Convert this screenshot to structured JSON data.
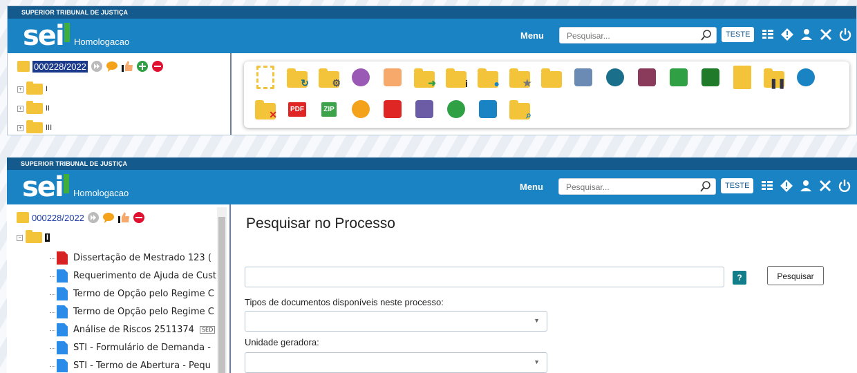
{
  "app": {
    "org": "SUPERIOR TRIBUNAL DE JUSTIÇA",
    "logo": "sei",
    "environment": "Homologacao",
    "menu_label": "Menu",
    "search_placeholder": "Pesquisar...",
    "user_badge": "TESTE"
  },
  "header_icons": [
    "list-icon",
    "alert-icon",
    "user-icon",
    "tools-icon",
    "power-icon"
  ],
  "process_number": "000228/2022",
  "tree_folders": [
    "I",
    "II",
    "III"
  ],
  "toolbar_row1": [
    "new-doc-icon",
    "relate-process-icon",
    "manage-users-icon",
    "view-icon",
    "assign-icon",
    "send-process-icon",
    "process-info-icon",
    "assign-person-icon",
    "highlight-icon",
    "block-icon",
    "email-icon",
    "refresh-icon",
    "add-attachment-icon",
    "units-icon",
    "brazil-map-icon",
    "note-icon",
    "pause-icon",
    "link-icon"
  ],
  "toolbar_row2": [
    "cancel-icon",
    "PDF",
    "ZIP",
    "comment-icon",
    "flag-icon",
    "tag-icon",
    "clock-icon",
    "list-icon",
    "search-folder-icon"
  ],
  "tree2_open_folder": "I",
  "documents": [
    {
      "title": "Dissertação de Mestrado 123 (",
      "type": "pdf"
    },
    {
      "title": "Requerimento de Ajuda de Cust",
      "type": "doc"
    },
    {
      "title": "Termo de Opção pelo Regime C",
      "type": "doc"
    },
    {
      "title": "Termo de Opção pelo Regime C",
      "type": "doc"
    },
    {
      "title": "Análise de Riscos 2511374",
      "type": "doc",
      "tag": "SED"
    },
    {
      "title": "STI - Formulário de Demanda -",
      "type": "doc"
    },
    {
      "title": "STI - Termo de Abertura - Pequ",
      "type": "doc"
    }
  ],
  "search_page": {
    "title": "Pesquisar no Processo",
    "help": "?",
    "button": "Pesquisar",
    "doc_types_label": "Tipos de documentos disponíveis neste processo:",
    "unit_label": "Unidade geradora:"
  },
  "colors": {
    "header": "#1a83c3",
    "topbar": "#155a8d",
    "folder": "#f3c43a"
  }
}
